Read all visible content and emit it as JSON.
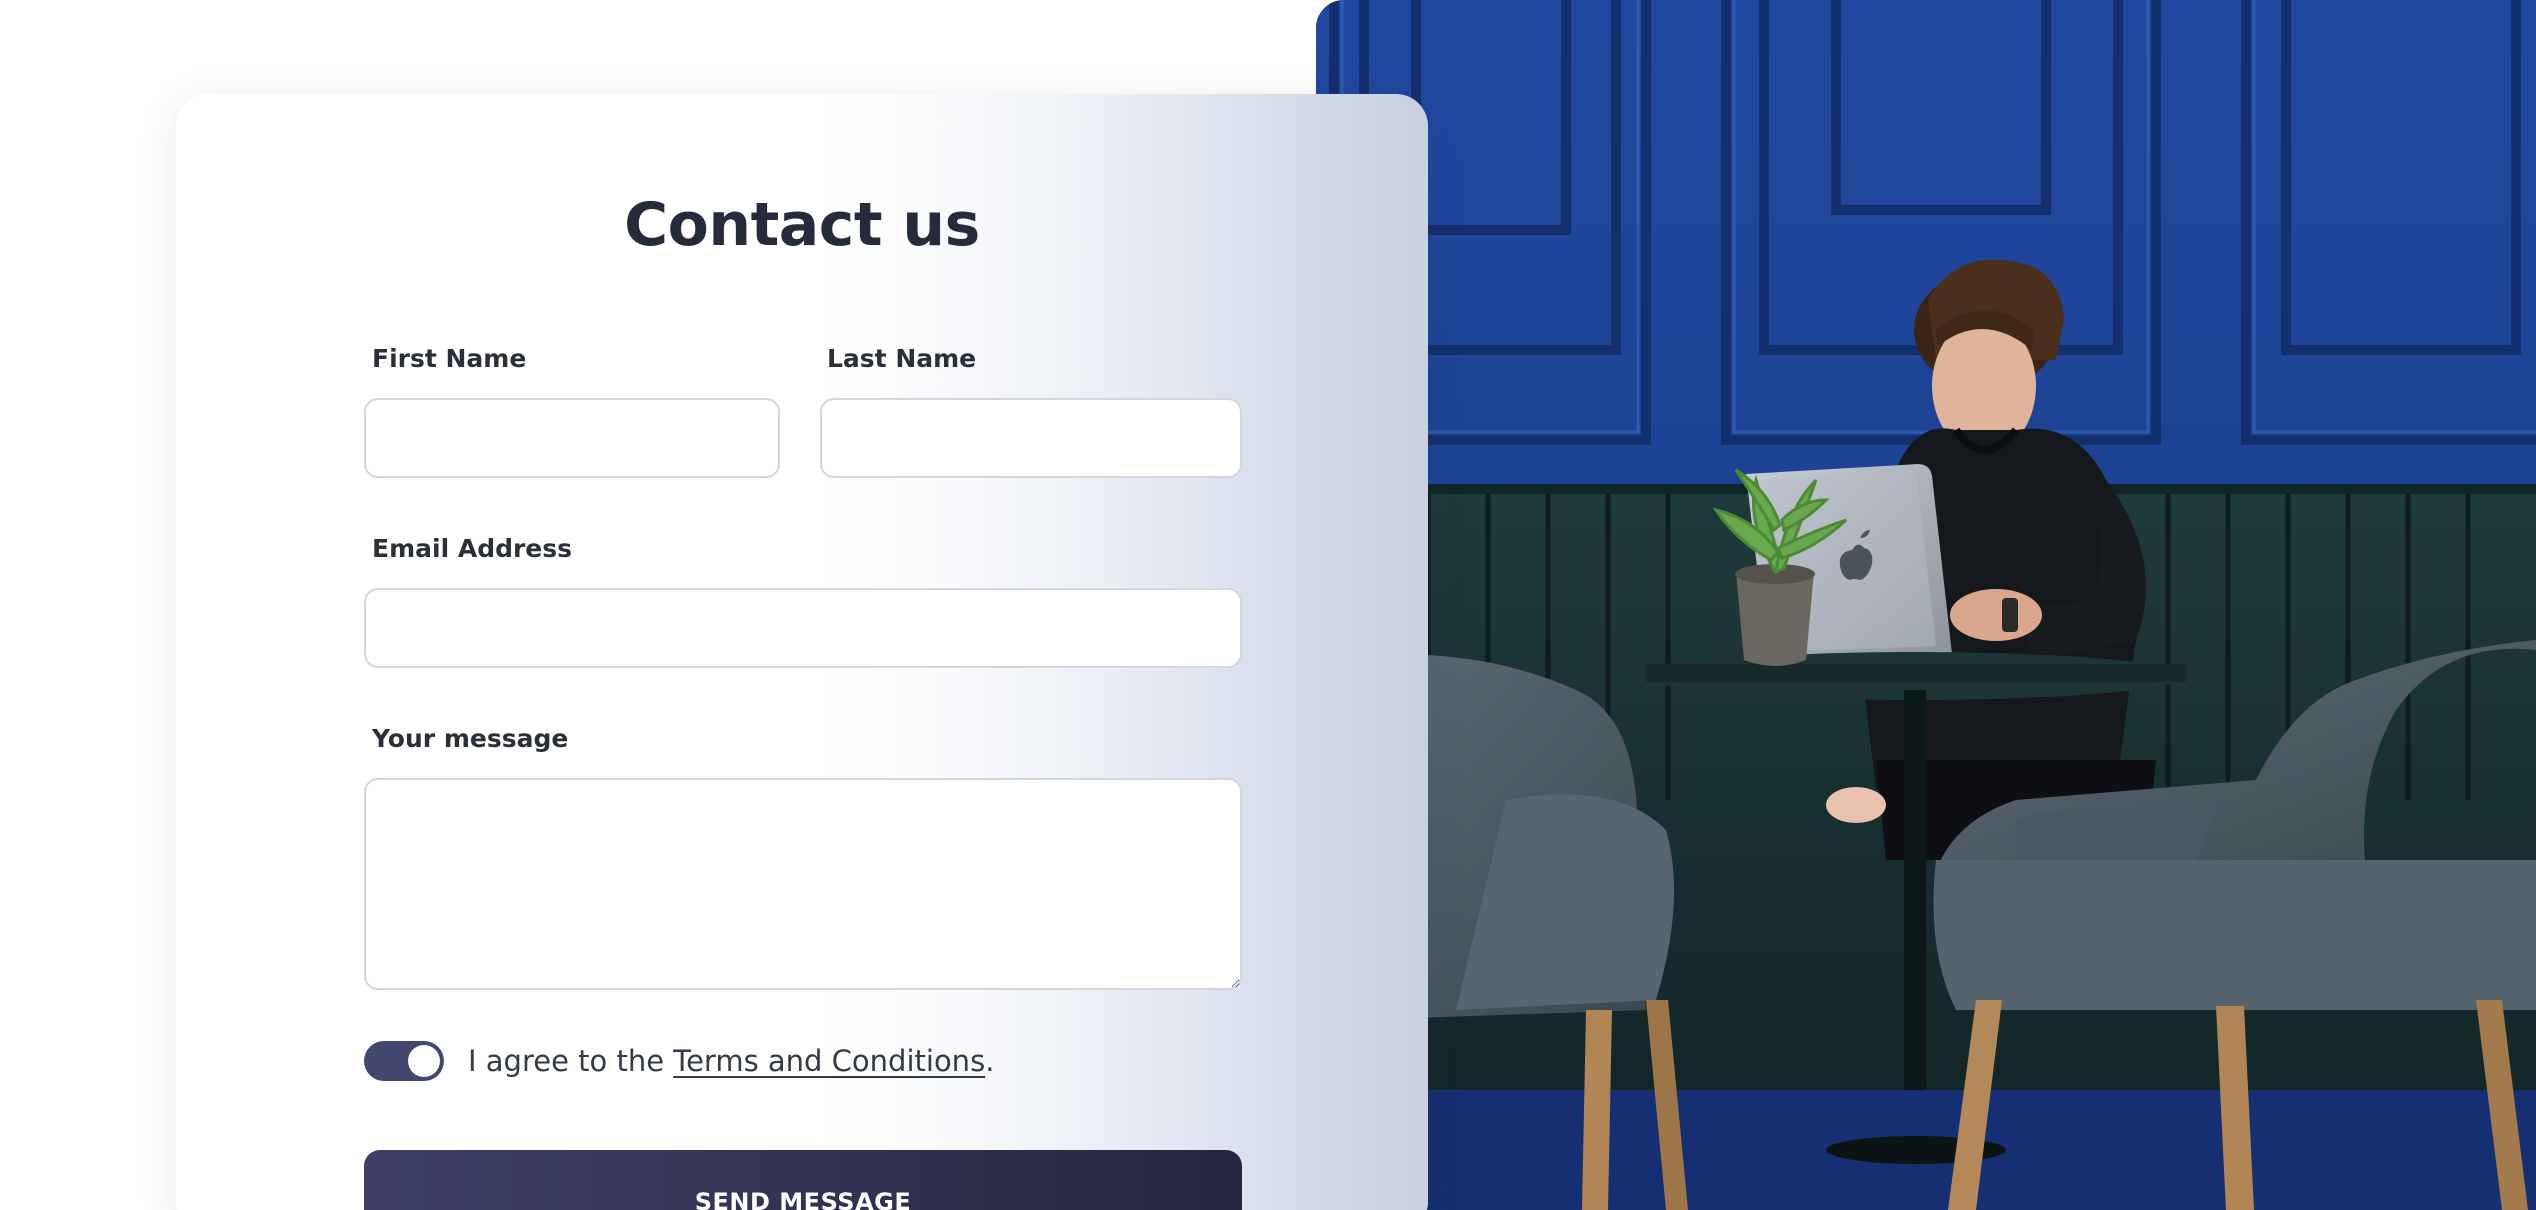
{
  "contact_form": {
    "title": "Contact us",
    "first_name": {
      "label": "First Name",
      "value": "",
      "placeholder": ""
    },
    "last_name": {
      "label": "Last Name",
      "value": "",
      "placeholder": ""
    },
    "email": {
      "label": "Email Address",
      "value": "",
      "placeholder": ""
    },
    "message": {
      "label": "Your message",
      "value": "",
      "placeholder": ""
    },
    "agreement": {
      "text_before": "I agree to the ",
      "link_text": "Terms and Conditions",
      "text_after": ".",
      "toggle_on": true
    },
    "submit_label": "SEND MESSAGE"
  },
  "colors": {
    "accent": "#42476f",
    "button": "#30304f",
    "title_text": "#252b3b",
    "photo_wall": "#1e3e86"
  },
  "icons": {
    "toggle": "toggle-switch-icon",
    "resize": "resize-handle-icon"
  }
}
